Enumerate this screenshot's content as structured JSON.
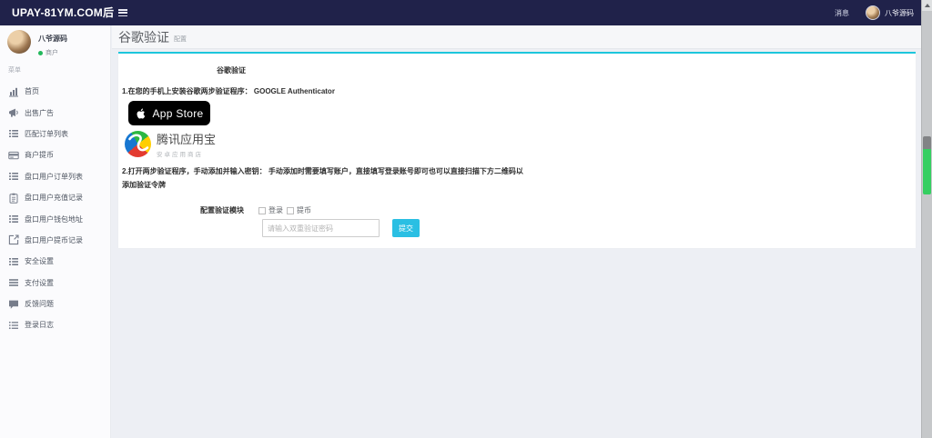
{
  "topbar": {
    "logo": "UPAY-81YM.COM后",
    "messages_label": "消息",
    "username": "八爷源码"
  },
  "sidebar": {
    "profile": {
      "name": "八爷源码",
      "status": "商户"
    },
    "section_label": "菜单",
    "items": [
      {
        "label": "首页",
        "icon": "chart-icon"
      },
      {
        "label": "出售广告",
        "icon": "megaphone-icon"
      },
      {
        "label": "匹配订单列表",
        "icon": "list-icon"
      },
      {
        "label": "商户提币",
        "icon": "card-icon"
      },
      {
        "label": "盘口用户订单列表",
        "icon": "list-icon"
      },
      {
        "label": "盘口用户充值记录",
        "icon": "clipboard-icon"
      },
      {
        "label": "盘口用户钱包地址",
        "icon": "list-icon"
      },
      {
        "label": "盘口用户提币记录",
        "icon": "external-link-icon"
      },
      {
        "label": "安全设置",
        "icon": "list-icon"
      },
      {
        "label": "支付设置",
        "icon": "menu-icon"
      },
      {
        "label": "反馈问题",
        "icon": "comment-icon"
      },
      {
        "label": "登录日志",
        "icon": "log-icon"
      }
    ]
  },
  "page": {
    "title": "谷歌验证",
    "subtitle": "配置"
  },
  "card": {
    "title": "谷歌验证",
    "step1": "1.在您的手机上安装谷歌两步验证程序： GOOGLE Authenticator",
    "appstore_label": "App Store",
    "tencent_name": "腾讯应用宝",
    "tencent_sub": "安卓应用商店",
    "step2": "2.打开两步验证程序，手动添加并输入密钥： 手动添加时需要填写账户，直接填写登录账号即可也可以直接扫描下方二维码以添加验证令牌",
    "form": {
      "module_label": "配置验证模块",
      "options": [
        {
          "label": "登录"
        },
        {
          "label": "提币"
        }
      ],
      "password_placeholder": "请输入双重验证密码",
      "submit_label": "提交"
    }
  },
  "colors": {
    "accent": "#1cc6dc",
    "topbar_bg": "#20224a",
    "submit_button": "#2abfe3",
    "status_green": "#23b85c"
  }
}
